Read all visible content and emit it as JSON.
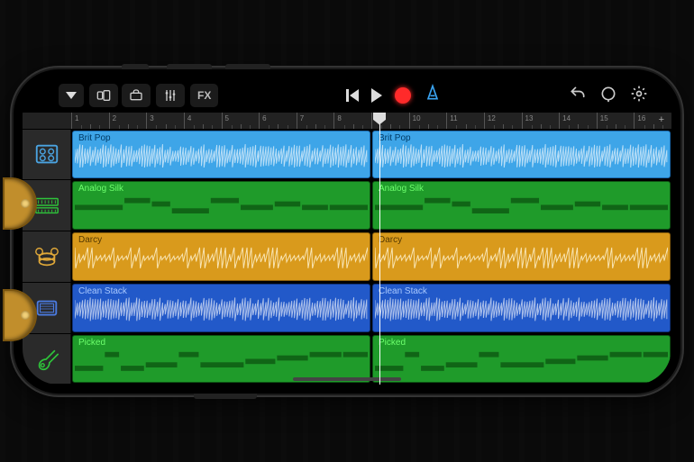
{
  "toolbar": {
    "fx_label": "FX"
  },
  "ruler": {
    "bars": [
      "1",
      "2",
      "3",
      "4",
      "5",
      "6",
      "7",
      "8",
      "9",
      "10",
      "11",
      "12",
      "13",
      "14",
      "15",
      "16"
    ],
    "plus": "+"
  },
  "playhead": {
    "bar": 8
  },
  "tracks": [
    {
      "name": "Brit Pop",
      "color": "t-blue1",
      "icon": "amp",
      "type": "audio"
    },
    {
      "name": "Analog Silk",
      "color": "t-green1",
      "icon": "synth",
      "type": "midi"
    },
    {
      "name": "Darcy",
      "color": "t-gold",
      "icon": "drums",
      "type": "audio-d"
    },
    {
      "name": "Clean Stack",
      "color": "t-blue2",
      "icon": "amp2",
      "type": "audio"
    },
    {
      "name": "Picked",
      "color": "t-green2",
      "icon": "guitar",
      "type": "midi"
    }
  ]
}
